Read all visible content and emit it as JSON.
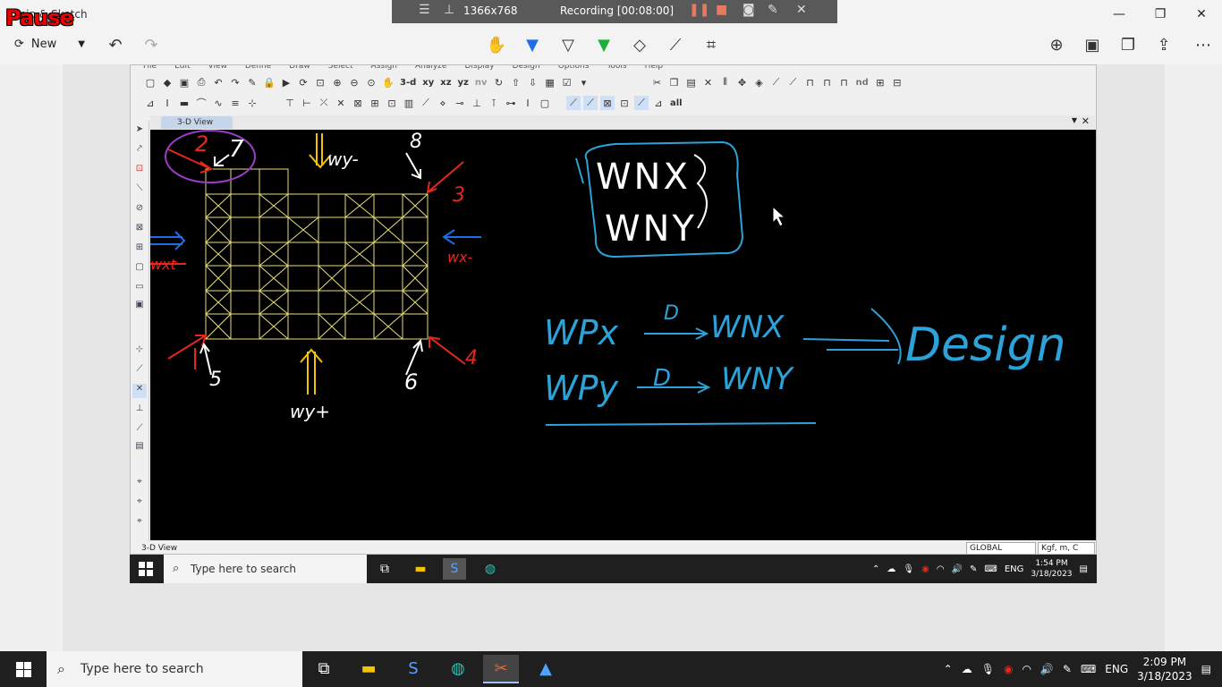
{
  "snip": {
    "title": "Snip & Sketch",
    "pause_label": "Pause",
    "new_label": "New",
    "controls": {
      "minimize": "—",
      "maximize": "❐",
      "close": "✕"
    }
  },
  "recorder": {
    "size": "1366x768",
    "status": "Recording [00:08:00]"
  },
  "app": {
    "menu": [
      "File",
      "Edit",
      "View",
      "Define",
      "Draw",
      "Select",
      "Assign",
      "Analyze",
      "Display",
      "Design",
      "Options",
      "Tools",
      "Help"
    ],
    "toolbar_text": [
      "3-d",
      "xy",
      "xz",
      "yz",
      "nv",
      "nd",
      "all"
    ],
    "tab_label": "3-D View",
    "status_label": "3-D View",
    "coord_system": "GLOBAL",
    "units": "Kgf, m, C"
  },
  "annotations": {
    "label_1": "2",
    "label_2": "7",
    "label_3": "8",
    "label_4": "3",
    "label_5": "4",
    "label_6": "5",
    "label_7": "6",
    "wy_minus": "wy-",
    "wy_plus": "wy+",
    "wx_plus": "wxt",
    "wx_minus": "wx-",
    "box_line1": "WNX",
    "box_line2": "WNY",
    "eq1_left": "WPx",
    "eq1_over": "D",
    "eq1_right": "WNX",
    "eq2_left": "WPy",
    "eq2_over": "D",
    "eq2_right": "WNY",
    "design": "Design",
    "colors": {
      "red": "#e8261d",
      "blue": "#1e6ee6",
      "cyan": "#2ba3d9",
      "yellow": "#f5c400",
      "purple": "#9a3dc7",
      "grid": "#e8e07a"
    }
  },
  "inner_taskbar": {
    "search_placeholder": "Type here to search",
    "lang": "ENG",
    "time": "1:54 PM",
    "date": "3/18/2023"
  },
  "taskbar": {
    "search_placeholder": "Type here to search",
    "lang": "ENG",
    "time": "2:09 PM",
    "date": "3/18/2023"
  }
}
